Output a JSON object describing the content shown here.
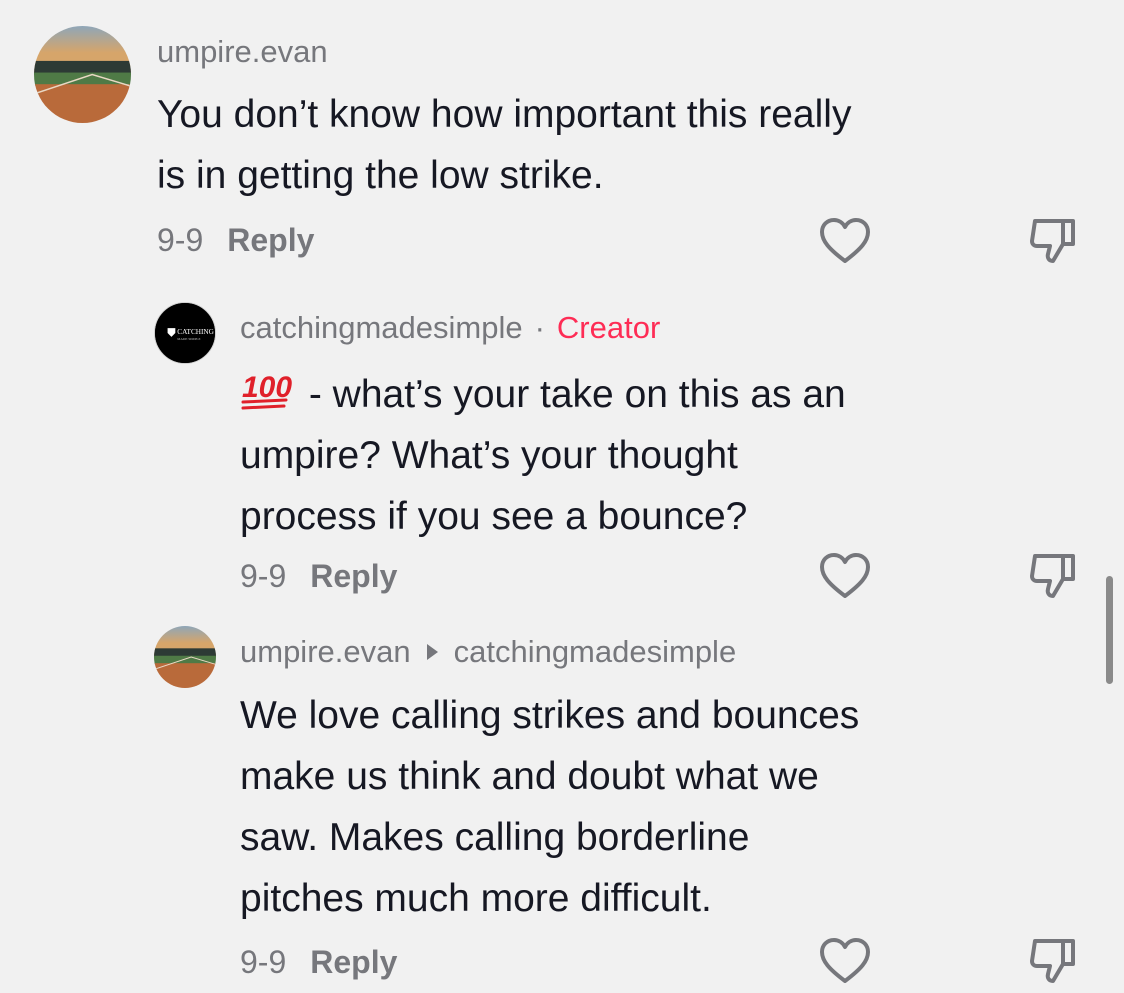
{
  "comments": [
    {
      "username": "umpire.evan",
      "badge": "",
      "reply_to": "",
      "lines": [
        "You don’t know how important this really",
        "is in getting the low strike."
      ],
      "date": "9-9",
      "reply_label": "Reply"
    },
    {
      "username": "catchingmadesimple",
      "badge_sep": "·",
      "badge": "Creator",
      "emoji": "100-emoji",
      "lines": [
        " - what’s your take on this as an",
        "umpire? What’s your thought",
        "process if you see a bounce?"
      ],
      "date": "9-9",
      "reply_label": "Reply"
    },
    {
      "username": "umpire.evan",
      "reply_to": "catchingmadesimple",
      "lines": [
        "We love calling strikes and bounces",
        "make us think and doubt what we",
        "saw. Makes calling borderline",
        "pitches much more difficult."
      ],
      "date": "9-9",
      "reply_label": "Reply"
    }
  ],
  "logo_text": {
    "line1": "CATCHING",
    "line2": "MADE SIMPLE"
  },
  "icons": {
    "like": "heart-outline-icon",
    "dislike": "thumbs-down-icon"
  },
  "colors": {
    "background": "#f1f1f1",
    "username": "#76777c",
    "creator_badge": "#fe2c55",
    "text": "#161823"
  }
}
